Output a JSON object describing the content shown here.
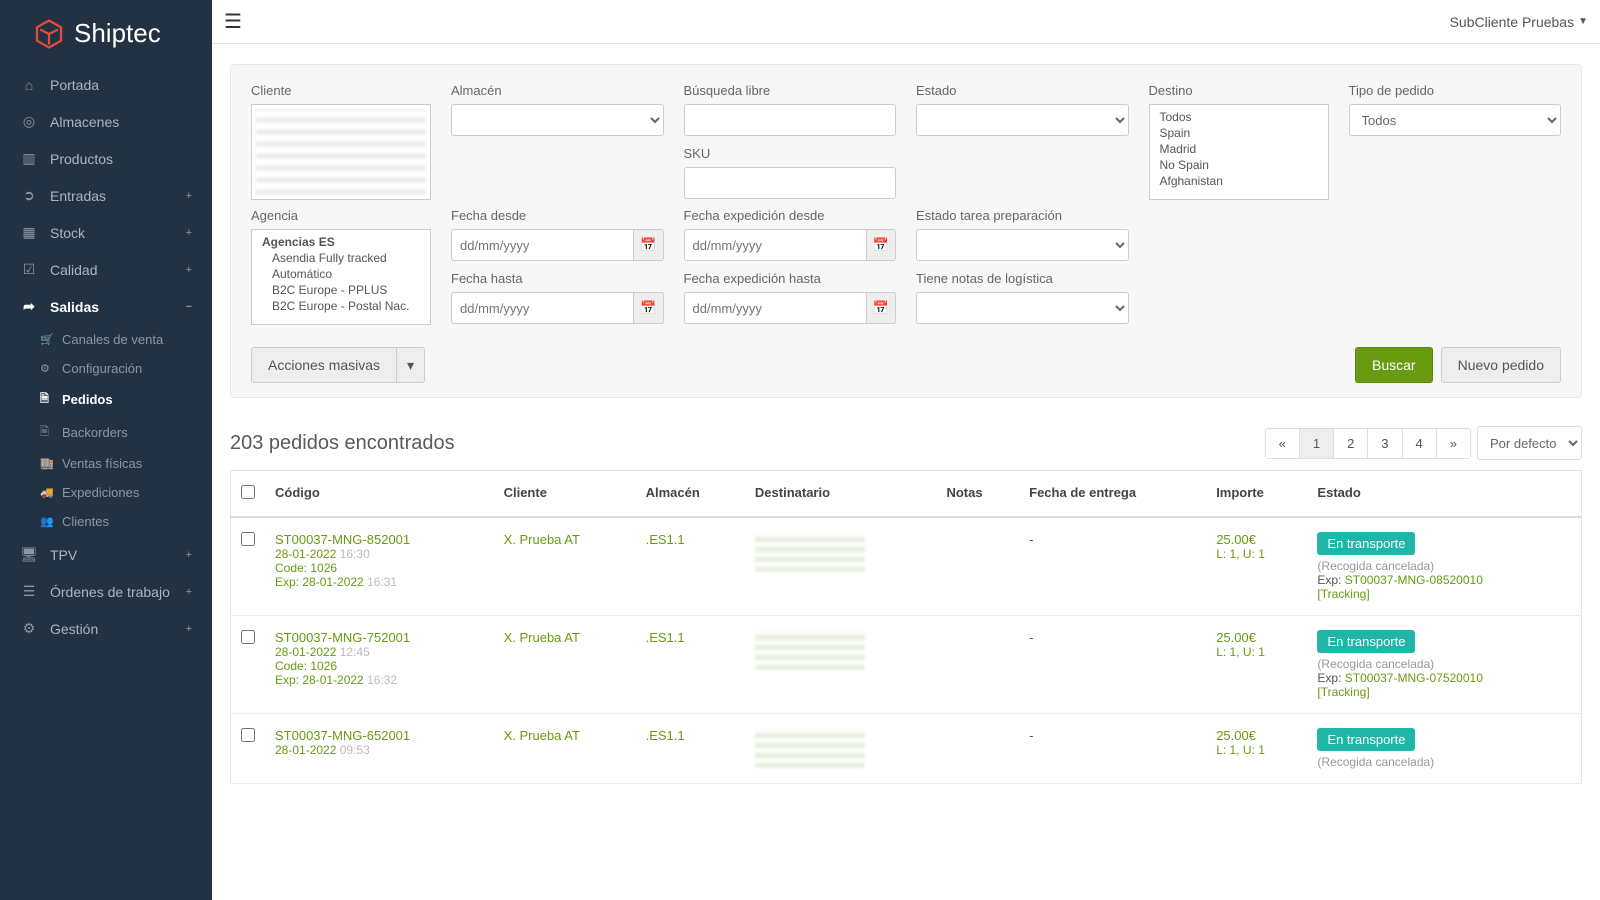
{
  "brand": "Shiptec",
  "topbar": {
    "user": "SubCliente Pruebas"
  },
  "nav": {
    "portada": "Portada",
    "almacenes": "Almacenes",
    "productos": "Productos",
    "entradas": "Entradas",
    "stock": "Stock",
    "calidad": "Calidad",
    "salidas": "Salidas",
    "tpv": "TPV",
    "ordenes": "Órdenes de trabajo",
    "gestion": "Gestión",
    "sub": {
      "canales": "Canales de venta",
      "config": "Configuración",
      "pedidos": "Pedidos",
      "backorders": "Backorders",
      "ventas": "Ventas físicas",
      "expediciones": "Expediciones",
      "clientes": "Clientes"
    }
  },
  "filters": {
    "cliente": "Cliente",
    "almacen": "Almacén",
    "busqueda": "Búsqueda libre",
    "estado": "Estado",
    "destino": "Destino",
    "tipo": "Tipo de pedido",
    "tipo_value": "Todos",
    "sku": "SKU",
    "agencia": "Agencia",
    "fecha_desde": "Fecha desde",
    "fecha_hasta": "Fecha hasta",
    "fecha_exp_desde": "Fecha expedición desde",
    "fecha_exp_hasta": "Fecha expedición hasta",
    "estado_tarea": "Estado tarea preparación",
    "tiene_notas": "Tiene notas de logística",
    "date_placeholder": "dd/mm/yyyy",
    "destino_opts": [
      "Todos",
      "Spain",
      "Madrid",
      "No Spain",
      "Afghanistan"
    ],
    "agencia_opts": {
      "header": "Agencias ES",
      "items": [
        "Asendia Fully tracked",
        "Automático",
        "B2C Europe - PPLUS",
        "B2C Europe - Postal Nac."
      ]
    }
  },
  "buttons": {
    "acciones": "Acciones masivas",
    "buscar": "Buscar",
    "nuevo": "Nuevo pedido",
    "sort": "Por defecto"
  },
  "results": {
    "summary": "203 pedidos encontrados"
  },
  "pagination": {
    "prev": "«",
    "next": "»",
    "pages": [
      "1",
      "2",
      "3",
      "4"
    ]
  },
  "table": {
    "headers": {
      "codigo": "Código",
      "cliente": "Cliente",
      "almacen": "Almacén",
      "destinatario": "Destinatario",
      "notas": "Notas",
      "fecha": "Fecha de entrega",
      "importe": "Importe",
      "estado": "Estado"
    },
    "rows": [
      {
        "codigo": "ST00037-MNG-852001",
        "fecha_line": "28-01-2022",
        "hora": "16:30",
        "code_line": "Code: 1026",
        "exp_line": "Exp: 28-01-2022",
        "exp_hora": "16:31",
        "cliente": "X. Prueba AT",
        "almacen": ".ES1.1",
        "fecha_entrega": "-",
        "importe": "25.00€",
        "lu": "L: 1, U: 1",
        "estado_badge": "En transporte",
        "estado_note": "(Recogida cancelada)",
        "exp_label": "Exp:",
        "exp_code": "ST00037-MNG-08520010",
        "tracking": "[Tracking]"
      },
      {
        "codigo": "ST00037-MNG-752001",
        "fecha_line": "28-01-2022",
        "hora": "12:45",
        "code_line": "Code: 1026",
        "exp_line": "Exp: 28-01-2022",
        "exp_hora": "16:32",
        "cliente": "X. Prueba AT",
        "almacen": ".ES1.1",
        "fecha_entrega": "-",
        "importe": "25.00€",
        "lu": "L: 1, U: 1",
        "estado_badge": "En transporte",
        "estado_note": "(Recogida cancelada)",
        "exp_label": "Exp:",
        "exp_code": "ST00037-MNG-07520010",
        "tracking": "[Tracking]"
      },
      {
        "codigo": "ST00037-MNG-652001",
        "fecha_line": "28-01-2022",
        "hora": "09:53",
        "code_line": "",
        "exp_line": "",
        "exp_hora": "",
        "cliente": "X. Prueba AT",
        "almacen": ".ES1.1",
        "fecha_entrega": "-",
        "importe": "25.00€",
        "lu": "L: 1, U: 1",
        "estado_badge": "En transporte",
        "estado_note": "(Recogida cancelada)",
        "exp_label": "",
        "exp_code": "",
        "tracking": ""
      }
    ]
  }
}
